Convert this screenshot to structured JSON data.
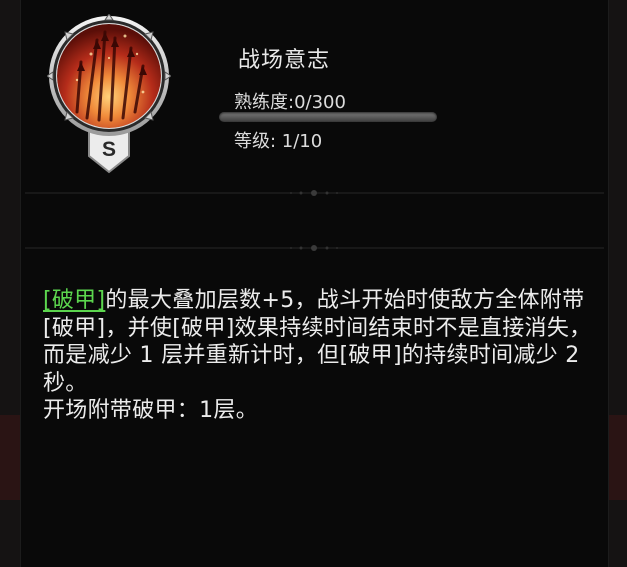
{
  "skill": {
    "name": "战场意志",
    "grade": "S",
    "icon": "spears-fire-icon",
    "proficiency_label": "熟练度:0/300",
    "proficiency_progress": 0,
    "level_label": "等级: 1/10"
  },
  "description": {
    "keyword": "[破甲]",
    "body": "的最大叠加层数+5，战斗开始时使敌方全体附带[破甲]，并使[破甲]效果持续时间结束时不是直接消失，而是减少 1 层并重新计时，但[破甲]的持续时间减少 2 秒。",
    "extra": "开场附带破甲：1层。"
  },
  "colors": {
    "keyword": "#5cd64e",
    "text": "#ececec",
    "panel_bg": "#090909",
    "emblem_red": "#b0261a"
  }
}
